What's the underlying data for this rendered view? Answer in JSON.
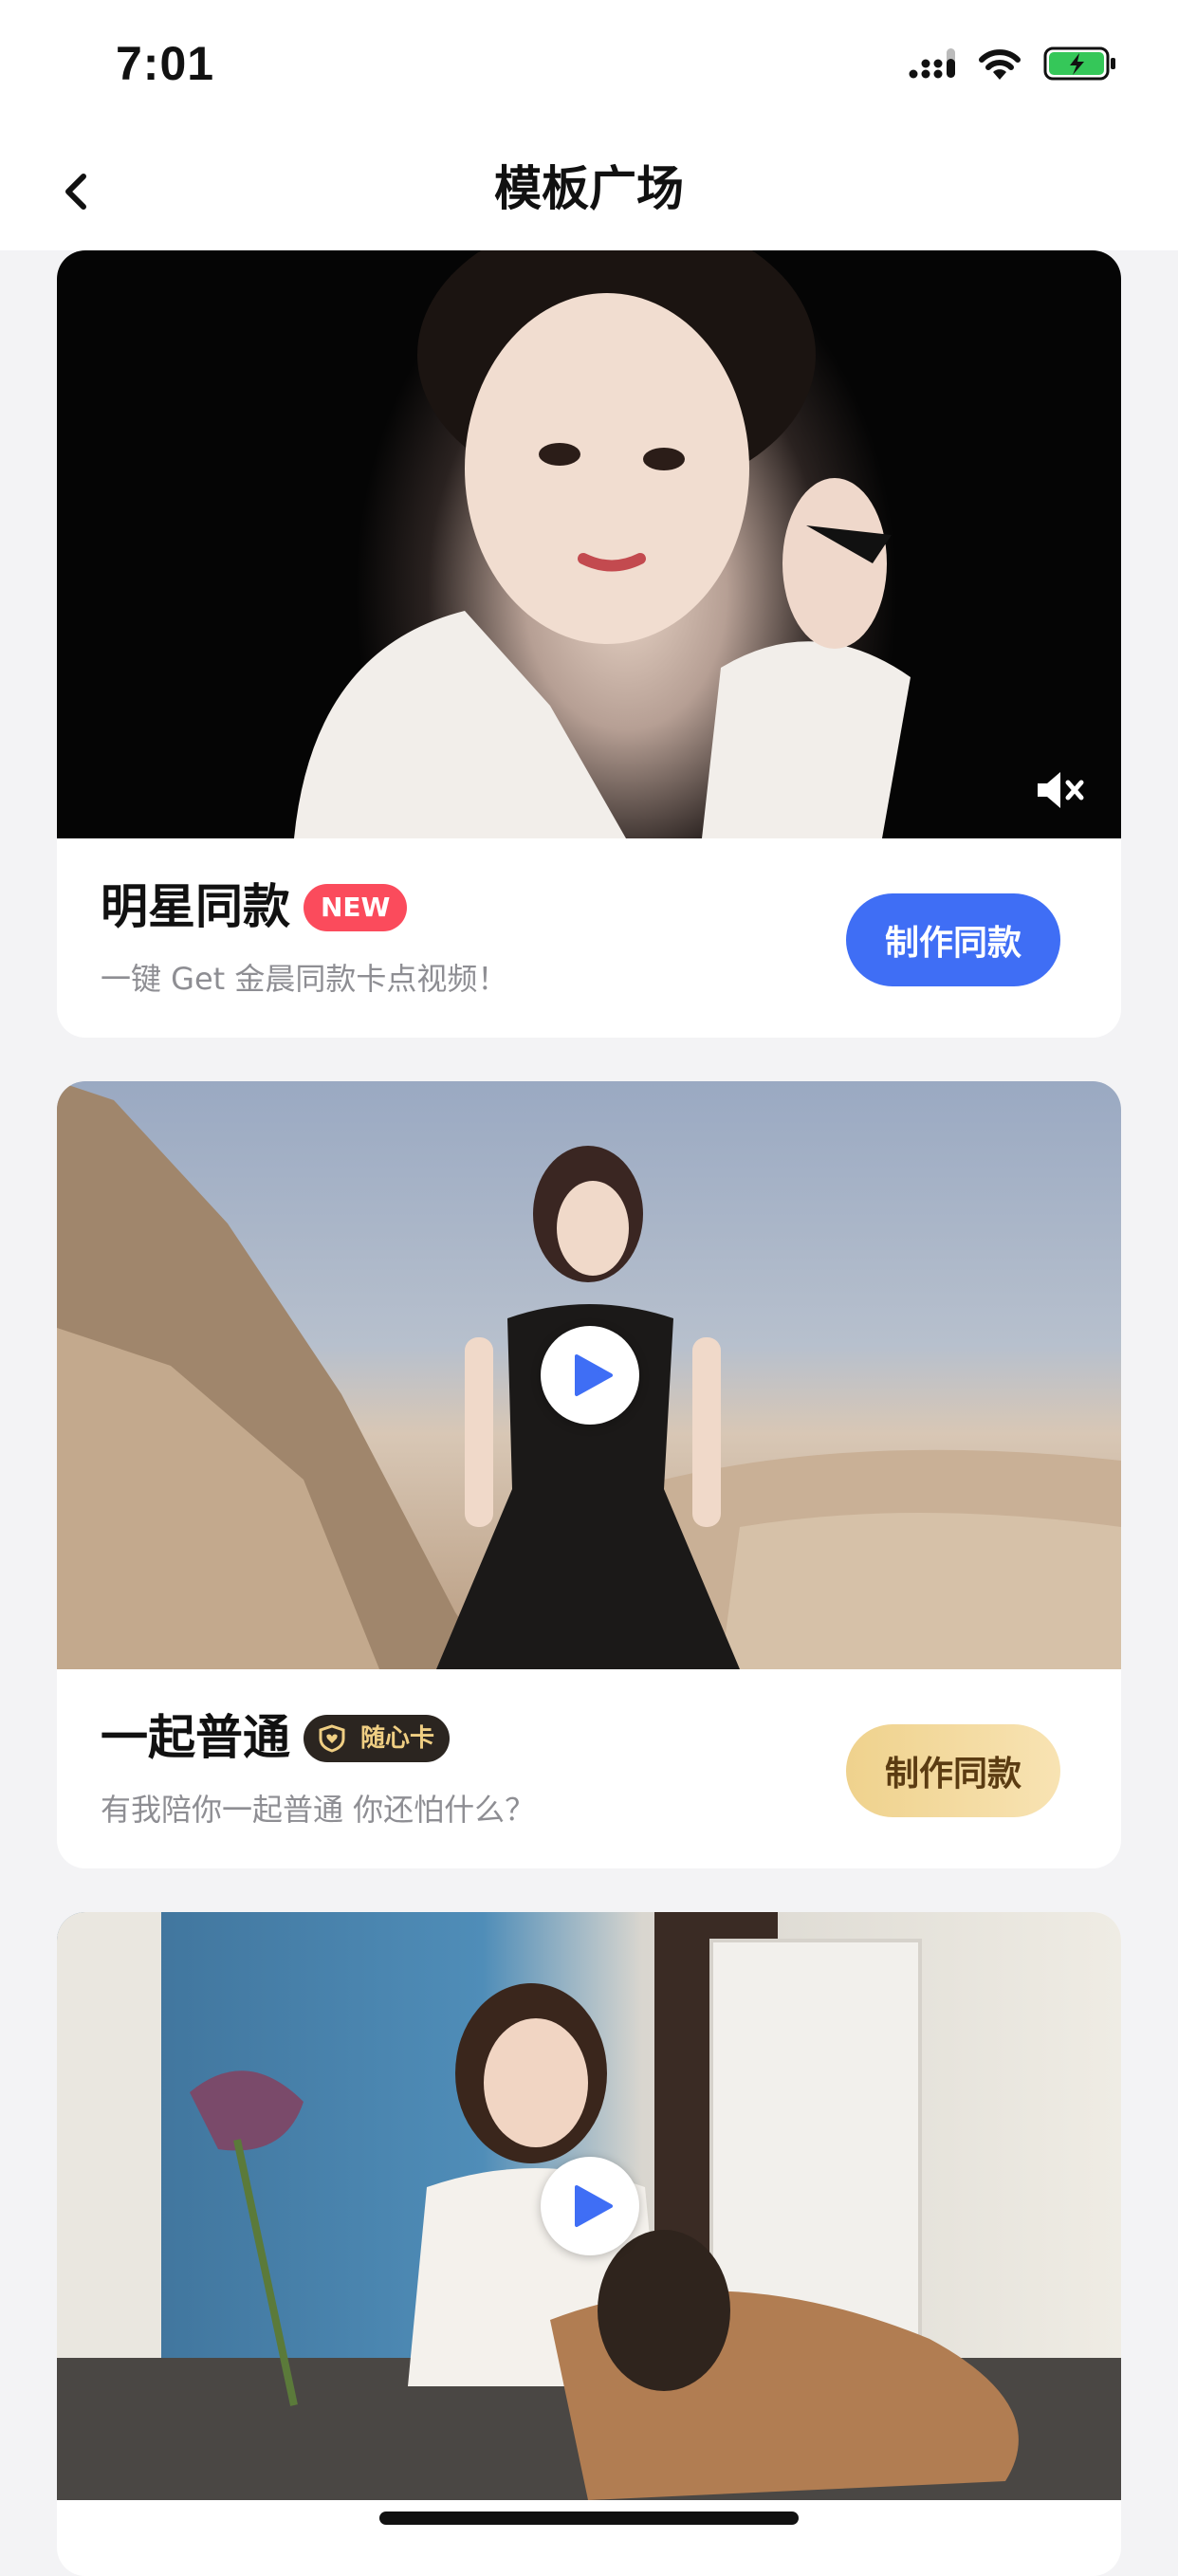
{
  "status_bar": {
    "time": "7:01"
  },
  "nav": {
    "title": "模板广场"
  },
  "cards": [
    {
      "title": "明星同款",
      "badge": "NEW",
      "subtitle": "一键 Get 金晨同款卡点视频！",
      "button_label": "制作同款"
    },
    {
      "title": "一起普通",
      "badge": "随心卡",
      "subtitle": "有我陪你一起普通 你还怕什么？",
      "button_label": "制作同款"
    },
    {
      "title": "",
      "badge": "",
      "subtitle": "",
      "button_label": ""
    }
  ],
  "colors": {
    "accent_blue": "#3f6ef5",
    "badge_red": "#fb4b5c",
    "gold": "#efd28d"
  },
  "icons": [
    "back-icon",
    "signal-icon",
    "wifi-icon",
    "battery-icon",
    "mute-icon",
    "play-icon",
    "heart-shield-icon"
  ]
}
